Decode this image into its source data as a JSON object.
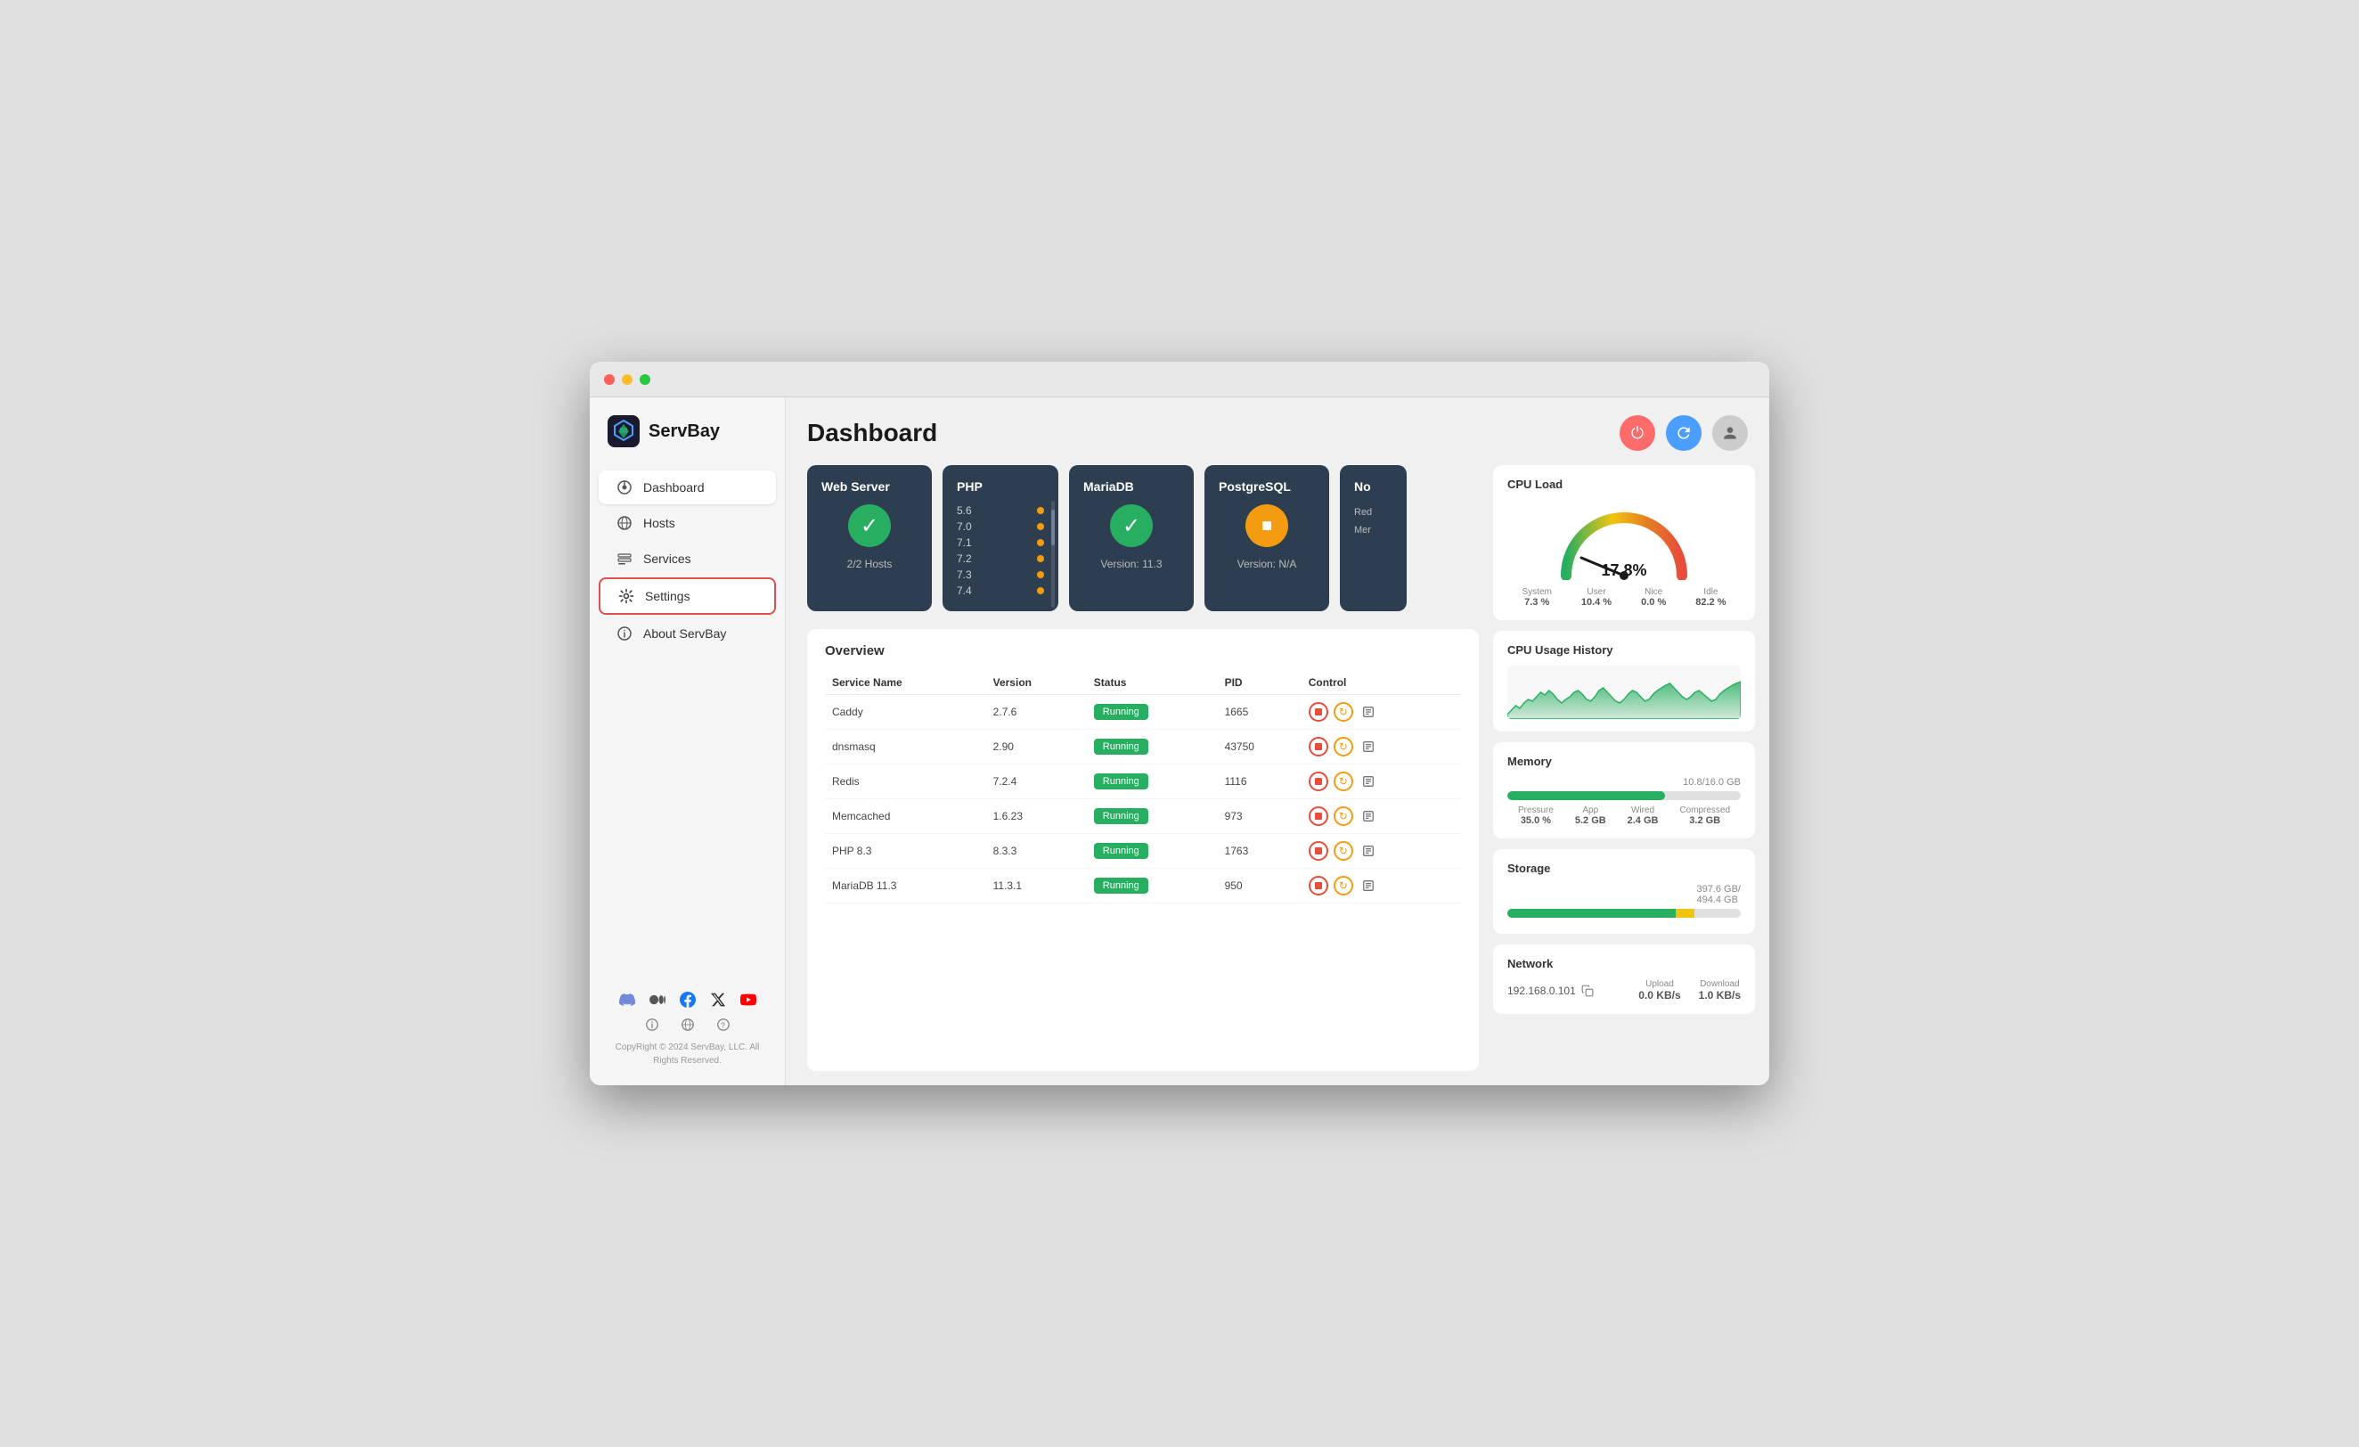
{
  "app": {
    "title": "ServBay",
    "logo_text": "ServBay"
  },
  "titlebar": {
    "buttons": [
      "close",
      "minimize",
      "maximize"
    ]
  },
  "sidebar": {
    "nav_items": [
      {
        "id": "dashboard",
        "label": "Dashboard",
        "icon": "dashboard-icon"
      },
      {
        "id": "hosts",
        "label": "Hosts",
        "icon": "globe-icon"
      },
      {
        "id": "services",
        "label": "Services",
        "icon": "services-icon"
      },
      {
        "id": "settings",
        "label": "Settings",
        "icon": "settings-icon",
        "selected": true
      },
      {
        "id": "about",
        "label": "About ServBay",
        "icon": "info-icon"
      }
    ],
    "social": [
      "discord",
      "medium",
      "facebook",
      "twitter",
      "youtube"
    ],
    "footer_icons": [
      "info",
      "globe",
      "help"
    ],
    "copyright": "CopyRight © 2024 ServBay, LLC.\nAll Rights Reserved."
  },
  "header": {
    "title": "Dashboard",
    "buttons": {
      "power": "⏻",
      "refresh": "↻",
      "user": "👤"
    }
  },
  "service_cards": [
    {
      "id": "web-server",
      "title": "Web Server",
      "status": "running",
      "subtitle": "2/2 Hosts"
    },
    {
      "id": "php",
      "title": "PHP",
      "versions": [
        "5.6",
        "7.0",
        "7.1",
        "7.2",
        "7.3",
        "7.4"
      ]
    },
    {
      "id": "mariadb",
      "title": "MariaDB",
      "status": "running",
      "subtitle": "Version: 11.3"
    },
    {
      "id": "postgresql",
      "title": "PostgreSQL",
      "status": "stopped",
      "subtitle": "Version: N/A"
    },
    {
      "id": "nol",
      "title": "No",
      "partial_texts": [
        "Red",
        "Mer"
      ]
    }
  ],
  "overview": {
    "title": "Overview",
    "columns": [
      "Service Name",
      "Version",
      "Status",
      "PID",
      "Control"
    ],
    "rows": [
      {
        "name": "Caddy",
        "version": "2.7.6",
        "status": "Running",
        "pid": "1665"
      },
      {
        "name": "dnsmasq",
        "version": "2.90",
        "status": "Running",
        "pid": "43750"
      },
      {
        "name": "Redis",
        "version": "7.2.4",
        "status": "Running",
        "pid": "1116"
      },
      {
        "name": "Memcached",
        "version": "1.6.23",
        "status": "Running",
        "pid": "973"
      },
      {
        "name": "PHP 8.3",
        "version": "8.3.3",
        "status": "Running",
        "pid": "1763"
      },
      {
        "name": "MariaDB 11.3",
        "version": "11.3.1",
        "status": "Running",
        "pid": "950"
      }
    ]
  },
  "cpu_load": {
    "title": "CPU Load",
    "percentage": "17.8%",
    "stats": [
      {
        "label": "System",
        "value": "7.3 %"
      },
      {
        "label": "User",
        "value": "10.4 %"
      },
      {
        "label": "Nice",
        "value": "0.0 %"
      },
      {
        "label": "Idle",
        "value": "82.2 %"
      }
    ]
  },
  "cpu_history": {
    "title": "CPU Usage History"
  },
  "memory": {
    "title": "Memory",
    "used": 10.8,
    "total": 16.0,
    "label": "10.8/16.0 GB",
    "fill_pct": 67.5,
    "stats": [
      {
        "label": "Pressure",
        "value": "35.0 %"
      },
      {
        "label": "App",
        "value": "5.2 GB"
      },
      {
        "label": "Wired",
        "value": "2.4 GB"
      },
      {
        "label": "Compressed",
        "value": "3.2 GB"
      }
    ]
  },
  "storage": {
    "title": "Storage",
    "used": 397.6,
    "total": 494.4,
    "label": "397.6 GB/\n494.4 GB",
    "green_pct": 72,
    "yellow_pct": 8
  },
  "network": {
    "title": "Network",
    "ip": "192.168.0.101",
    "upload_label": "Upload",
    "upload_value": "0.0 KB/s",
    "download_label": "Download",
    "download_value": "1.0 KB/s"
  }
}
